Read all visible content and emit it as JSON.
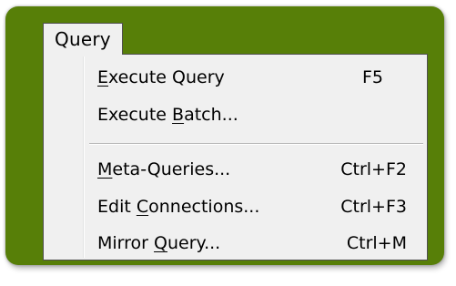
{
  "menubar": {
    "title": "Query"
  },
  "menu": {
    "items": [
      {
        "pre": "",
        "mnemonic": "E",
        "post": "xecute Query",
        "shortcut": "F5"
      },
      {
        "pre": "Execute ",
        "mnemonic": "B",
        "post": "atch...",
        "shortcut": ""
      },
      {
        "pre": "",
        "mnemonic": "M",
        "post": "eta-Queries...",
        "shortcut": "Ctrl+F2"
      },
      {
        "pre": "Edit ",
        "mnemonic": "C",
        "post": "onnections...",
        "shortcut": "Ctrl+F3"
      },
      {
        "pre": "Mirror ",
        "mnemonic": "Q",
        "post": "uery...",
        "shortcut": "Ctrl+M"
      }
    ]
  },
  "colors": {
    "frame": "#577f08",
    "menu_background": "#f0f0f0",
    "menu_border": "#4f4f4f",
    "text": "#000000"
  }
}
